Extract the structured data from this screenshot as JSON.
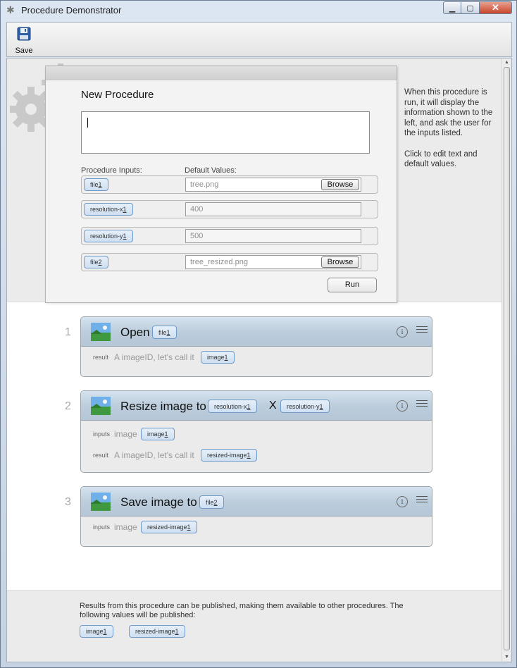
{
  "window": {
    "title": "Procedure Demonstrator",
    "title_icon": "gear-icon",
    "close_glyph": "✕",
    "min_glyph": "▁",
    "max_glyph": "▢"
  },
  "toolbar": {
    "save_label": "Save"
  },
  "dialog": {
    "title": "New Procedure",
    "description_value": "",
    "inputs_label": "Procedure Inputs:",
    "defaults_label": "Default Values:",
    "inputs": [
      {
        "name": "file",
        "suffix": "1",
        "value": "tree.png",
        "browse": "Browse"
      },
      {
        "name": "resolution-x",
        "suffix": "1",
        "value": "400"
      },
      {
        "name": "resolution-y",
        "suffix": "1",
        "value": "500"
      },
      {
        "name": "file",
        "suffix": "2",
        "value": "tree_resized.png",
        "browse": "Browse"
      }
    ],
    "run_label": "Run"
  },
  "help_text": {
    "p1": "When this procedure is run, it will display the information shown to the left, and ask the user for the inputs listed.",
    "p2": "Click to edit text and default values."
  },
  "steps": [
    {
      "number": "1",
      "title": "Open",
      "param": {
        "name": "file",
        "suffix": "1"
      },
      "result_label": "result",
      "result_text": "A imageID, let's call it",
      "result_chip": {
        "name": "image",
        "suffix": "1"
      }
    },
    {
      "number": "2",
      "title": "Resize image to",
      "param1": {
        "name": "resolution-x",
        "suffix": "1"
      },
      "x_sep": "X",
      "param2": {
        "name": "resolution-y",
        "suffix": "1"
      },
      "inputs_label": "inputs",
      "inputs_text": "image",
      "inputs_chip": {
        "name": "image",
        "suffix": "1"
      },
      "result_label": "result",
      "result_text": "A imageID, let's call it",
      "result_chip": {
        "name": "resized-image",
        "suffix": "1"
      }
    },
    {
      "number": "3",
      "title": "Save image to",
      "param": {
        "name": "file",
        "suffix": "2"
      },
      "inputs_label": "inputs",
      "inputs_text": "image",
      "inputs_chip": {
        "name": "resized-image",
        "suffix": "1"
      }
    }
  ],
  "publish": {
    "text": "Results from this procedure can be published, making them available to other procedures. The following values will be published:",
    "chips": [
      {
        "name": "image",
        "suffix": "1"
      },
      {
        "name": "resized-image",
        "suffix": "1"
      }
    ]
  },
  "colors": {
    "chip_border": "#6e9ac8",
    "chip_fill": "#dbe7f5",
    "step_header": "#c4d3e2"
  },
  "icons": [
    "gear-icon",
    "save-icon",
    "image-icon",
    "info-icon",
    "menu-icon"
  ]
}
